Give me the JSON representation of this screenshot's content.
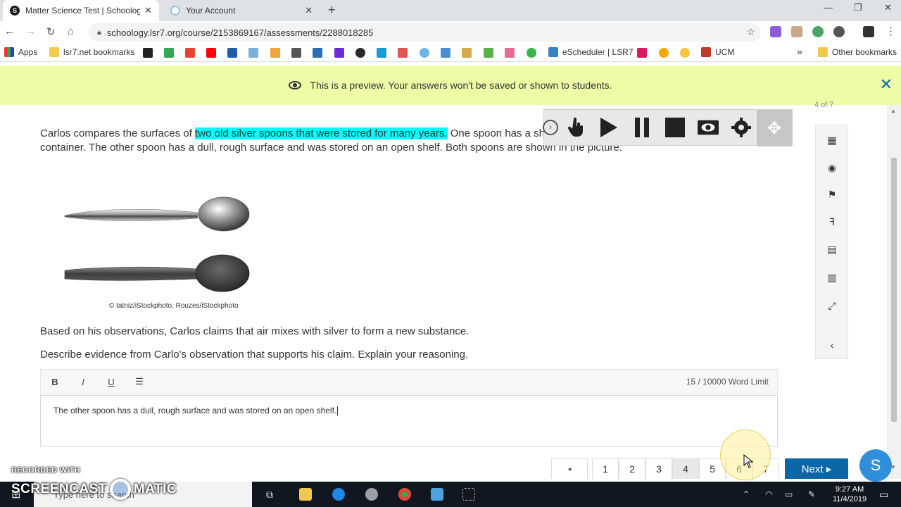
{
  "browser": {
    "tabs": [
      {
        "title": "Matter Science Test | Schoology",
        "favicon": "S"
      },
      {
        "title": "Your Account",
        "favicon": ""
      }
    ],
    "url": "schoology.lsr7.org/course/2153869167/assessments/2288018285",
    "bookmarks": [
      "Apps",
      "lsr7.net bookmarks",
      "eScheduler | LSR7",
      "UCM",
      "Other bookmarks"
    ]
  },
  "banner": {
    "text": "This is a preview. Your answers won't be saved or shown to students."
  },
  "question": {
    "progress": "4 of 7",
    "intro_before": "Carlos compares the surfaces of ",
    "highlighted": "two old silver spoons that were stored for many years.",
    "intro_after": "  One spoon has a shiny, smooth surface and was stored in an airtight container.  The other spoon has a dull, rough surface and was stored on an open shelf.  Both spoons are shown in the picture.",
    "caption": "© tatniz/iStockphoto, Rouzes/iStockphoto",
    "claim": "Based on his observations, Carlos claims that air mixes with silver to form a new substance.",
    "prompt": "Describe evidence from Carlo's observation that supports his claim.  Explain your reasoning."
  },
  "editor": {
    "bold": "B",
    "italic": "I",
    "underline": "U",
    "word_count": "15 / 10000 Word Limit",
    "answer": "The other spoon has a dull, rough surface and was stored on an open shelf."
  },
  "pager": {
    "pages": [
      "1",
      "2",
      "3",
      "4",
      "5",
      "6",
      "7"
    ],
    "current": "4",
    "next_label": "Next ▸",
    "prev_label": "◂"
  },
  "taskbar": {
    "search_placeholder": "Type here to search",
    "time": "9:27 AM",
    "date": "11/4/2019"
  },
  "watermark": {
    "line1": "RECORDED WITH",
    "line2_left": "SCREENCAST",
    "line2_right": "MATIC"
  },
  "help": {
    "label": "S"
  },
  "colors": {
    "banner_bg": "#eefca6",
    "highlight": "#00ffff",
    "accent": "#0b66a6",
    "help": "#2f8fdb"
  }
}
